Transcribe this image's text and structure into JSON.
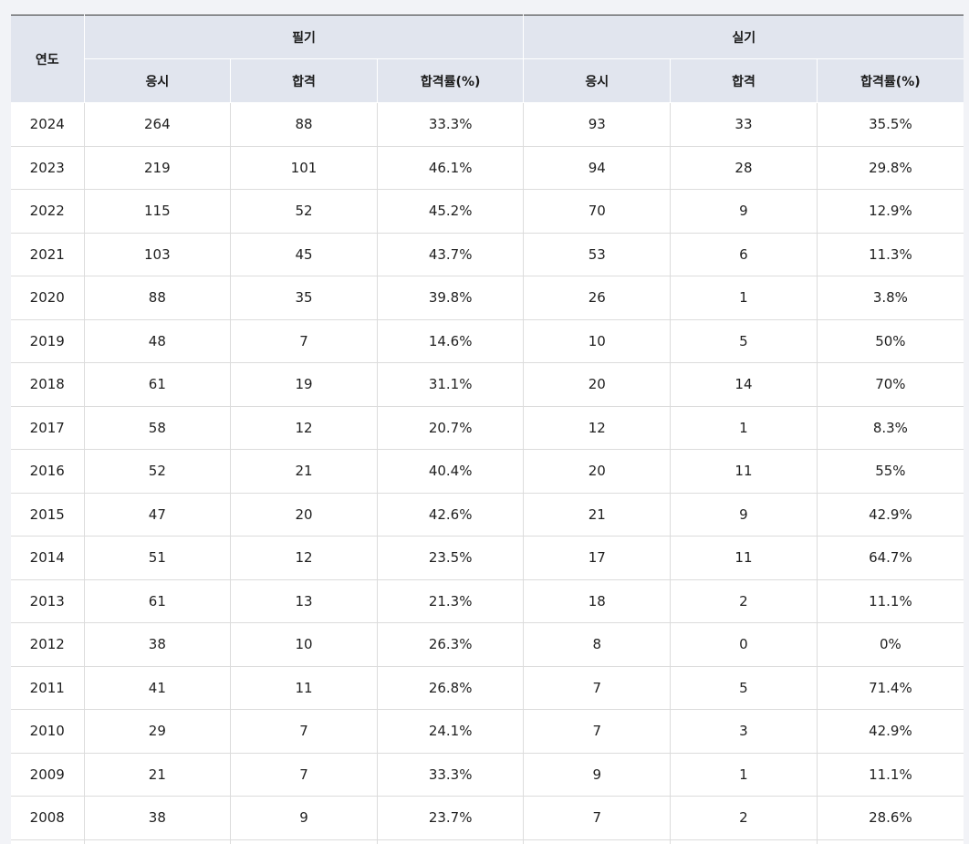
{
  "header": {
    "year": "연도",
    "written_group": "필기",
    "practical_group": "실기",
    "sub": [
      "응시",
      "합격",
      "합격률(%)",
      "응시",
      "합격",
      "합격률(%)"
    ]
  },
  "rows": [
    [
      "2024",
      "264",
      "88",
      "33.3%",
      "93",
      "33",
      "35.5%"
    ],
    [
      "2023",
      "219",
      "101",
      "46.1%",
      "94",
      "28",
      "29.8%"
    ],
    [
      "2022",
      "115",
      "52",
      "45.2%",
      "70",
      "9",
      "12.9%"
    ],
    [
      "2021",
      "103",
      "45",
      "43.7%",
      "53",
      "6",
      "11.3%"
    ],
    [
      "2020",
      "88",
      "35",
      "39.8%",
      "26",
      "1",
      "3.8%"
    ],
    [
      "2019",
      "48",
      "7",
      "14.6%",
      "10",
      "5",
      "50%"
    ],
    [
      "2018",
      "61",
      "19",
      "31.1%",
      "20",
      "14",
      "70%"
    ],
    [
      "2017",
      "58",
      "12",
      "20.7%",
      "12",
      "1",
      "8.3%"
    ],
    [
      "2016",
      "52",
      "21",
      "40.4%",
      "20",
      "11",
      "55%"
    ],
    [
      "2015",
      "47",
      "20",
      "42.6%",
      "21",
      "9",
      "42.9%"
    ],
    [
      "2014",
      "51",
      "12",
      "23.5%",
      "17",
      "11",
      "64.7%"
    ],
    [
      "2013",
      "61",
      "13",
      "21.3%",
      "18",
      "2",
      "11.1%"
    ],
    [
      "2012",
      "38",
      "10",
      "26.3%",
      "8",
      "0",
      "0%"
    ],
    [
      "2011",
      "41",
      "11",
      "26.8%",
      "7",
      "5",
      "71.4%"
    ],
    [
      "2010",
      "29",
      "7",
      "24.1%",
      "7",
      "3",
      "42.9%"
    ],
    [
      "2009",
      "21",
      "7",
      "33.3%",
      "9",
      "1",
      "11.1%"
    ],
    [
      "2008",
      "38",
      "9",
      "23.7%",
      "7",
      "2",
      "28.6%"
    ],
    [
      "",
      "",
      "",
      "",
      "",
      "",
      ""
    ]
  ],
  "colors": {
    "header_bg": "#e1e5ee",
    "page_bg": "#f2f3f7",
    "grid_line": "#dcdcdc"
  }
}
